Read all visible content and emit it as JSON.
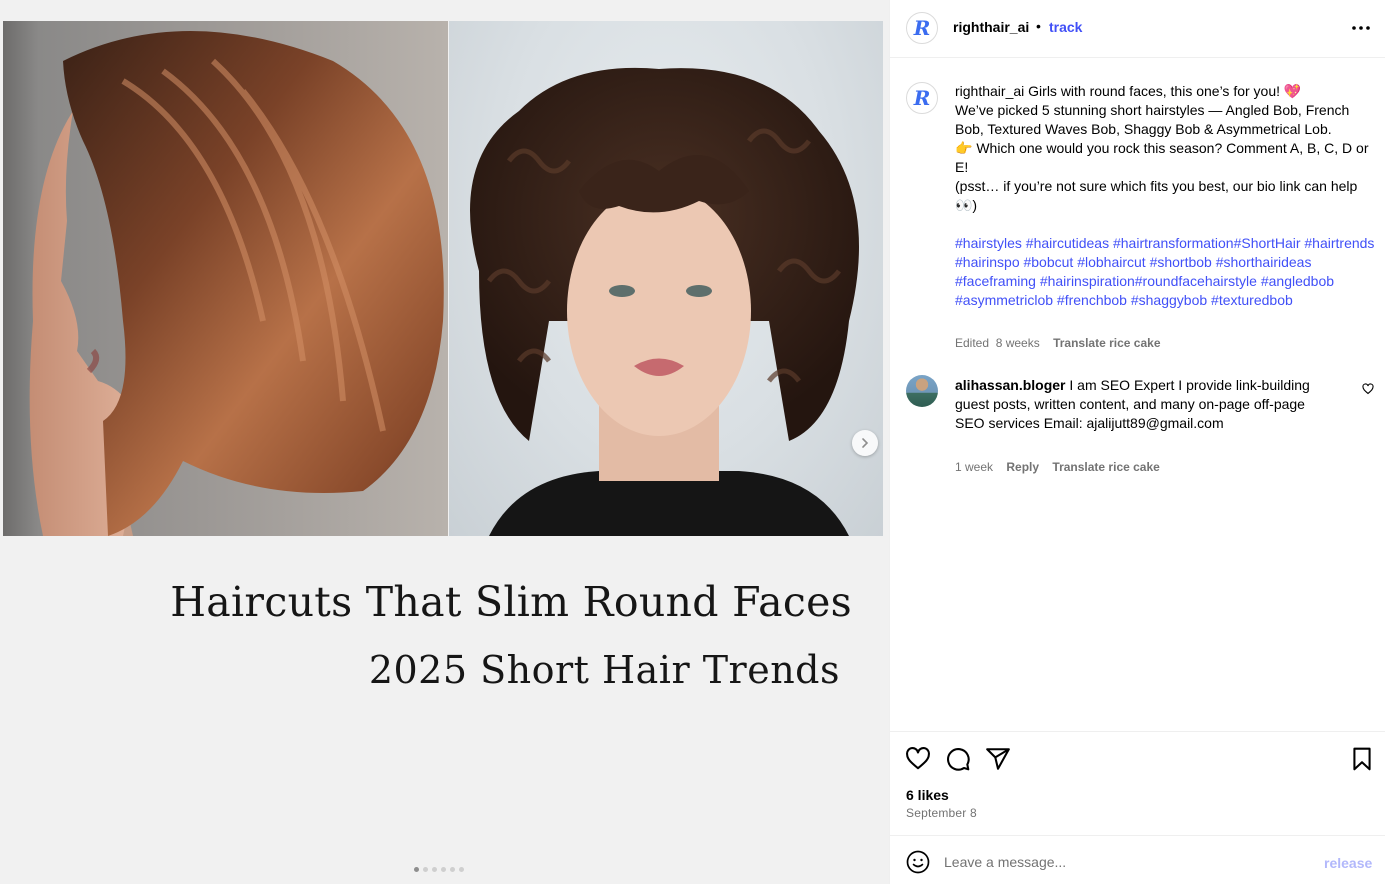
{
  "post": {
    "headline_line1": "Haircuts That Slim Round Faces",
    "headline_line2": "2025 Short Hair Trends",
    "carousel_count": 6,
    "carousel_index": 1
  },
  "header": {
    "username": "righthair_ai",
    "separator": "•",
    "follow_label": "track"
  },
  "caption": {
    "username": "righthair_ai",
    "text_line1": "Girls with round faces, this one’s for you! 💖",
    "text_body": "We’ve picked 5 stunning short hairstyles — Angled Bob, French Bob, Textured Waves Bob, Shaggy Bob & Asymmetrical Lob.",
    "text_question": "👉 Which one would you rock this season? Comment A, B, C, D or E!",
    "text_ps": "(psst… if you’re not sure which fits you best, our bio link can help 👀)",
    "hashtags": "#hairstyles #haircutideas #hairtransformation#ShortHair #hairtrends #hairinspo #bobcut #lobhaircut #shortbob #shorthairideas #faceframing #hairinspiration#roundfacehairstyle #angledbob #asymmetriclob #frenchbob #shaggybob #texturedbob",
    "edited_label": "Edited",
    "edited_time": "8 weeks",
    "translate_label": "Translate rice cake"
  },
  "comments": [
    {
      "username": "alihassan.bloger",
      "text": "I am SEO Expert I provide link-building guest posts, written content, and many on-page off-page SEO services Email: ajalijutt89@gmail.com",
      "time": "1 week",
      "reply_label": "Reply",
      "translate_label": "Translate rice cake"
    }
  ],
  "stats": {
    "likes": "6 likes",
    "date": "September 8"
  },
  "composer": {
    "placeholder": "Leave a message...",
    "post_label": "release"
  },
  "colors": {
    "link_blue": "#4150f7",
    "brand_blue": "#3b6cf0",
    "post_disabled": "#b2b8fb",
    "muted": "#737373"
  },
  "icons": {
    "like": "heart-icon",
    "comment": "comment-bubble-icon",
    "share": "paper-plane-icon",
    "save": "bookmark-icon",
    "more": "more-horizontal-icon",
    "emoji": "smiley-icon",
    "next": "chevron-right-icon"
  }
}
